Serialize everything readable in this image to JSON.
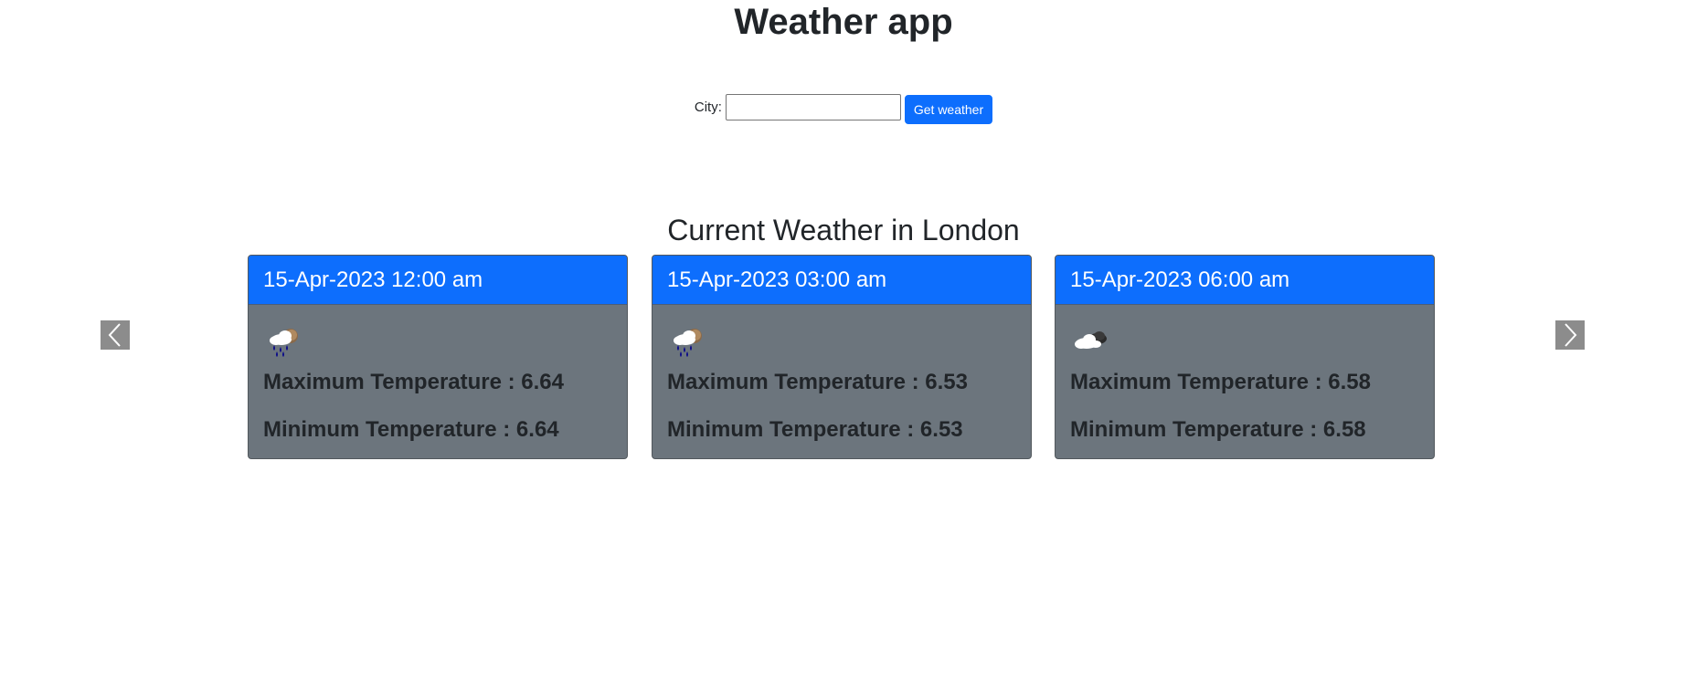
{
  "app": {
    "title": "Weather app"
  },
  "search": {
    "city_label": "City:",
    "city_value": "",
    "button_label": "Get weather"
  },
  "section": {
    "title": "Current Weather in London"
  },
  "colors": {
    "accent": "#0d6efd",
    "card_body": "#6c757d",
    "arrow_bg": "#8c8c8c"
  },
  "forecast": [
    {
      "datetime": "15-Apr-2023 12:00 am",
      "icon": "rain-cloud-sun-icon",
      "max_temp": "Maximum Temperature : 6.64",
      "min_temp": "Minimum Temperature : 6.64"
    },
    {
      "datetime": "15-Apr-2023 03:00 am",
      "icon": "rain-cloud-sun-icon",
      "max_temp": "Maximum Temperature : 6.53",
      "min_temp": "Minimum Temperature : 6.53"
    },
    {
      "datetime": "15-Apr-2023 06:00 am",
      "icon": "cloudy-icon",
      "max_temp": "Maximum Temperature : 6.58",
      "min_temp": "Minimum Temperature : 6.58"
    }
  ],
  "carousel": {
    "prev_icon": "chevron-left-icon",
    "next_icon": "chevron-right-icon"
  }
}
